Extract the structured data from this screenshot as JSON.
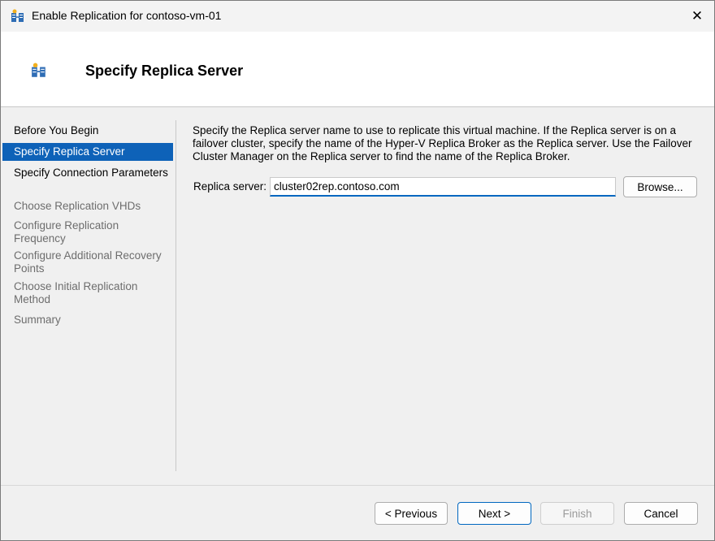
{
  "window": {
    "title": "Enable Replication for contoso-vm-01",
    "close_glyph": "✕"
  },
  "header": {
    "title": "Specify Replica Server"
  },
  "sidebar": {
    "items": [
      {
        "label": "Before You Begin",
        "state": "done"
      },
      {
        "label": "Specify Replica Server",
        "state": "active"
      },
      {
        "label": "Specify Connection Parameters",
        "state": "done"
      },
      {
        "label": "Choose Replication VHDs",
        "state": "disabled"
      },
      {
        "label": "Configure Replication Frequency",
        "state": "disabled"
      },
      {
        "label": "Configure Additional Recovery Points",
        "state": "disabled"
      },
      {
        "label": "Choose Initial Replication Method",
        "state": "disabled"
      },
      {
        "label": "Summary",
        "state": "disabled"
      }
    ]
  },
  "main": {
    "description": "Specify the Replica server name to use to replicate this virtual machine. If the Replica server is on a failover cluster, specify the name of the Hyper-V Replica Broker as the Replica server. Use the Failover Cluster Manager on the Replica server to find the name of the Replica Broker.",
    "replica_label": "Replica server:",
    "replica_value": "cluster02rep.contoso.com",
    "browse_label": "Browse..."
  },
  "footer": {
    "previous_label": "< Previous",
    "next_label": "Next >",
    "finish_label": "Finish",
    "cancel_label": "Cancel"
  },
  "colors": {
    "accent": "#0e62b8",
    "focus_underline": "#0067c0"
  },
  "icons": {
    "app": "hyper-v-replica-icon",
    "close": "close-icon"
  }
}
